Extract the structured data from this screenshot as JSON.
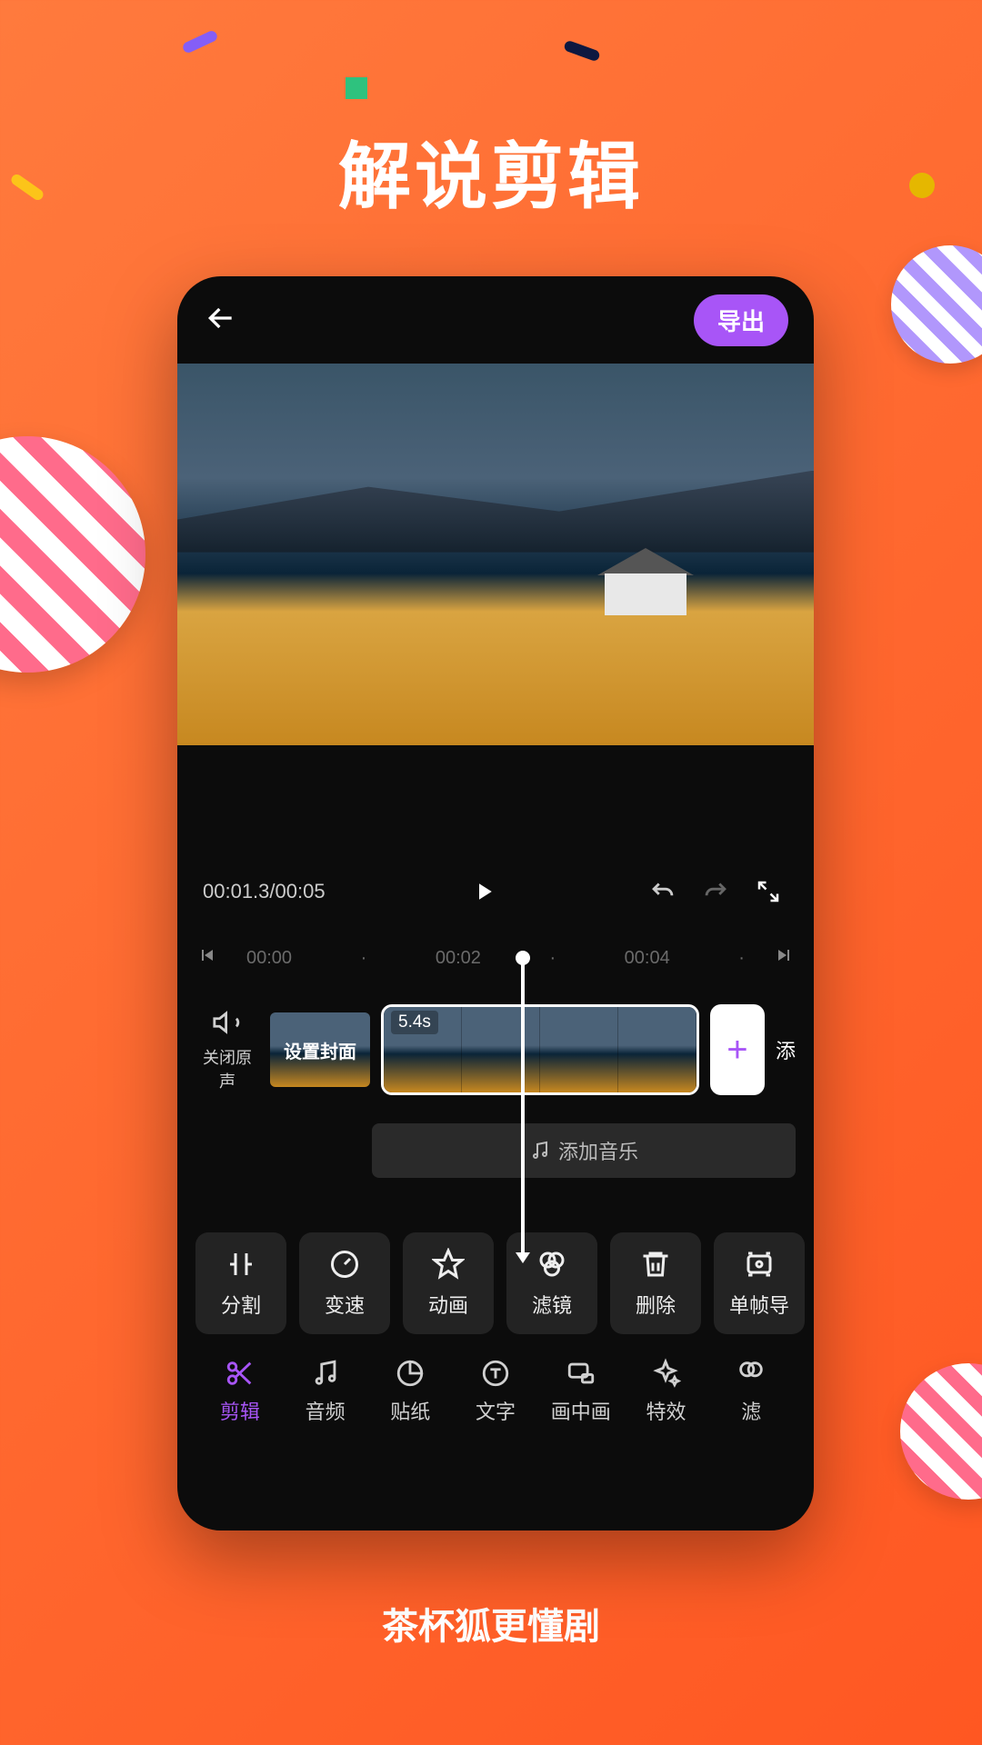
{
  "page": {
    "title": "解说剪辑",
    "subtitle": "茶杯狐更懂剧"
  },
  "header": {
    "export_label": "导出"
  },
  "playbar": {
    "current_time": "00:01.3",
    "total_time": "00:05"
  },
  "ruler": {
    "ticks": [
      "00:00",
      "00:02",
      "00:04"
    ]
  },
  "timeline": {
    "mute_label": "关闭原声",
    "cover_label": "设置封面",
    "clip_duration": "5.4s",
    "add_label": "添"
  },
  "music_row": {
    "label": "添加音乐"
  },
  "tools": [
    {
      "label": "分割"
    },
    {
      "label": "变速"
    },
    {
      "label": "动画"
    },
    {
      "label": "滤镜"
    },
    {
      "label": "删除"
    },
    {
      "label": "单帧导"
    }
  ],
  "tabs": [
    {
      "label": "剪辑",
      "active": true
    },
    {
      "label": "音频"
    },
    {
      "label": "贴纸"
    },
    {
      "label": "文字"
    },
    {
      "label": "画中画"
    },
    {
      "label": "特效"
    },
    {
      "label": "滤"
    }
  ]
}
